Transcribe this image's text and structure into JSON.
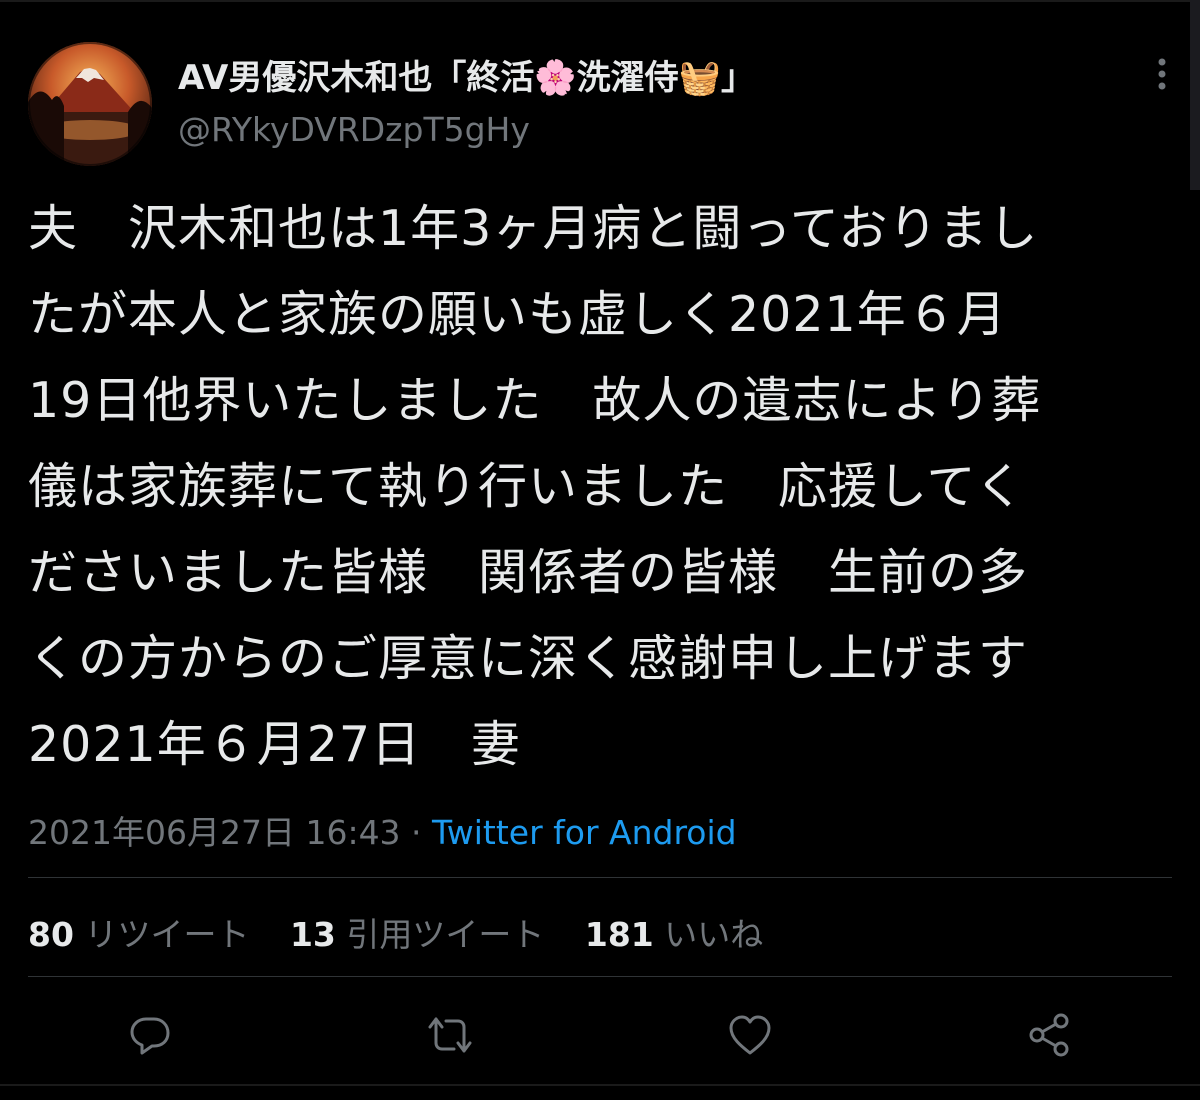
{
  "user": {
    "display_name": "AV男優沢木和也「終活🌸洗濯侍🧺」",
    "handle": "@RYkyDVRDzpT5gHy"
  },
  "tweet": {
    "lines": [
      "夫　沢木和也は1年3ヶ月病と闘っておりまし",
      "たが本人と家族の願いも虚しく2021年６月",
      "19日他界いたしました　故人の遺志により葬",
      "儀は家族葬にて執り行いました　応援してく",
      "ださいました皆様　関係者の皆様　生前の多",
      "くの方からのご厚意に深く感謝申し上げます",
      "2021年６月27日　妻"
    ],
    "timestamp": "2021年06月27日 16:43",
    "separator": " · ",
    "source": "Twitter for Android"
  },
  "stats": {
    "retweets_count": "80",
    "retweets_label": "リツイート",
    "quotes_count": "13",
    "quotes_label": "引用ツイート",
    "likes_count": "181",
    "likes_label": "いいね"
  },
  "actions": {
    "icons": [
      "reply-icon",
      "retweet-icon",
      "like-icon",
      "share-icon"
    ]
  },
  "colors": {
    "background": "#000000",
    "text": "#e7e9ea",
    "secondary": "#71767b",
    "link": "#1d9bf0",
    "divider": "#2f3336"
  }
}
